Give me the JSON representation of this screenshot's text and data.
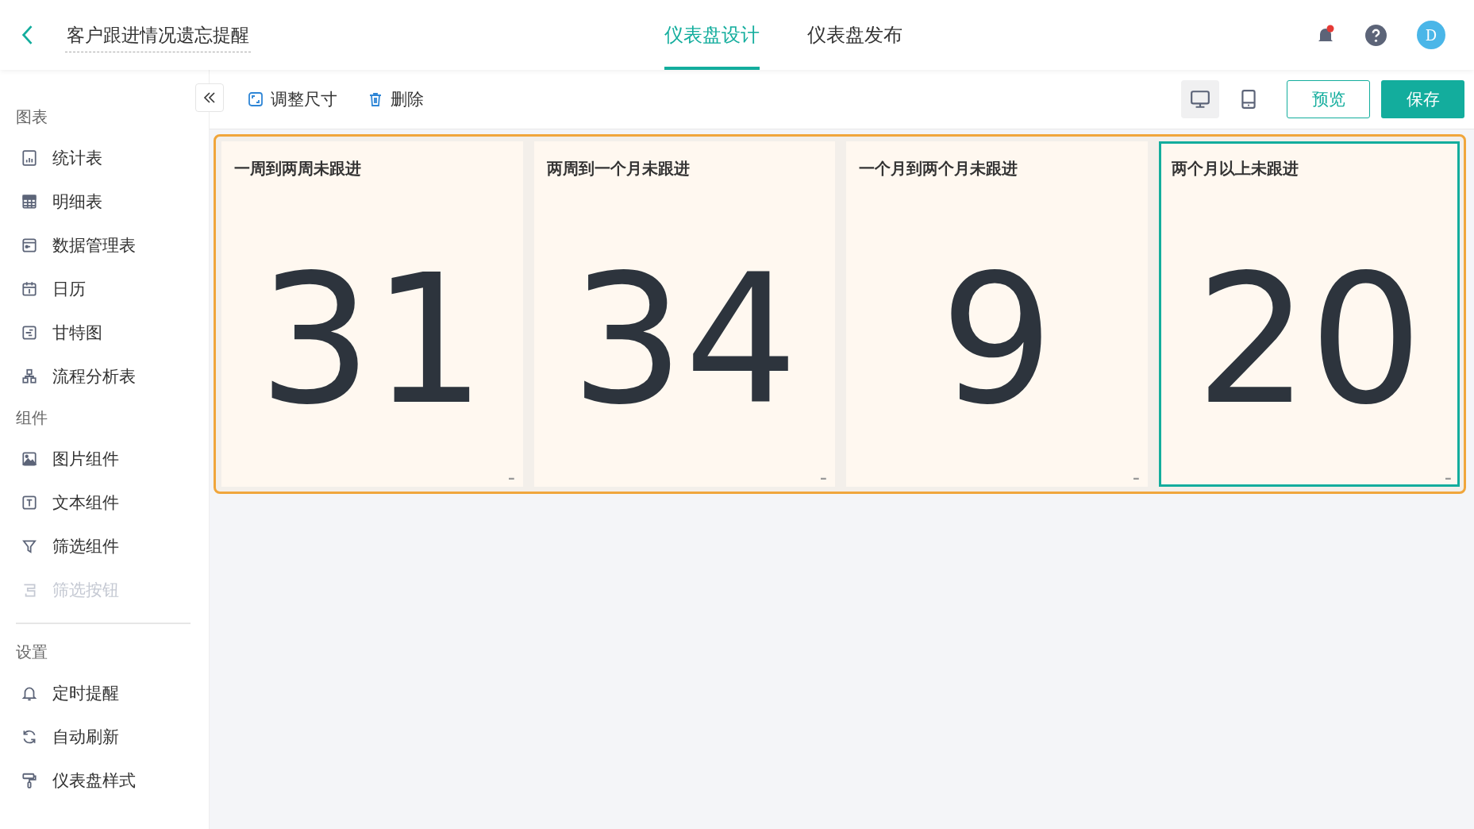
{
  "header": {
    "title": "客户跟进情况遗忘提醒",
    "tabs": [
      {
        "label": "仪表盘设计",
        "selected": true
      },
      {
        "label": "仪表盘发布",
        "selected": false
      }
    ],
    "notifications": {
      "unread": true
    },
    "avatar": "D"
  },
  "sidebar": {
    "sections": [
      {
        "title": "图表",
        "items": [
          {
            "label": "统计表",
            "kind": "stat",
            "disabled": false
          },
          {
            "label": "明细表",
            "kind": "grid",
            "disabled": false
          },
          {
            "label": "数据管理表",
            "kind": "data",
            "disabled": false
          },
          {
            "label": "日历",
            "kind": "calendar",
            "disabled": false
          },
          {
            "label": "甘特图",
            "kind": "gantt",
            "disabled": false
          },
          {
            "label": "流程分析表",
            "kind": "flow",
            "disabled": false
          }
        ]
      },
      {
        "title": "组件",
        "items": [
          {
            "label": "图片组件",
            "kind": "image",
            "disabled": false
          },
          {
            "label": "文本组件",
            "kind": "text",
            "disabled": false
          },
          {
            "label": "筛选组件",
            "kind": "filter",
            "disabled": false
          },
          {
            "label": "筛选按钮",
            "kind": "filterbtn",
            "disabled": true
          }
        ]
      },
      {
        "title": "设置",
        "items": [
          {
            "label": "定时提醒",
            "kind": "bell",
            "disabled": false
          },
          {
            "label": "自动刷新",
            "kind": "refresh",
            "disabled": false
          },
          {
            "label": "仪表盘样式",
            "kind": "roller",
            "disabled": false
          }
        ]
      }
    ]
  },
  "toolbar": {
    "actions": [
      {
        "label": "调整尺寸",
        "kind": "resize"
      },
      {
        "label": "删除",
        "kind": "delete"
      }
    ],
    "views": [
      {
        "kind": "desktop",
        "selected": true
      },
      {
        "kind": "mobile",
        "selected": false
      }
    ],
    "buttons": [
      {
        "label": "预览",
        "kind": "secondary"
      },
      {
        "label": "保存",
        "kind": "primary"
      }
    ]
  },
  "cards": [
    {
      "title": "一周到两周未跟进",
      "value": "31",
      "selected": false
    },
    {
      "title": "两周到一个月未跟进",
      "value": "34",
      "selected": false
    },
    {
      "title": "一个月到两个月未跟进",
      "value": "9",
      "selected": false
    },
    {
      "title": "两个月以上未跟进",
      "value": "20",
      "selected": true
    }
  ]
}
